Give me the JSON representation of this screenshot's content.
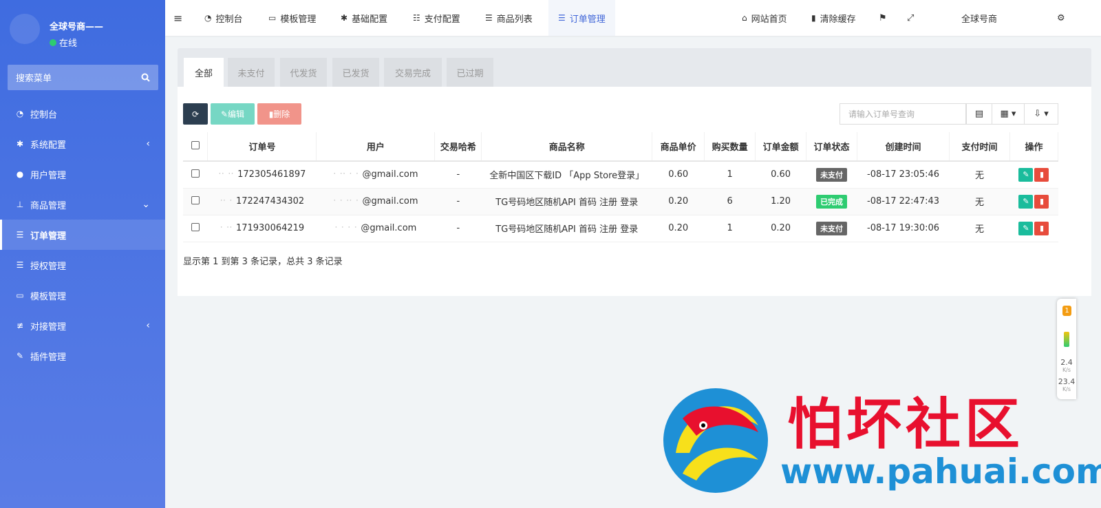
{
  "sidebar": {
    "username": "全球号商——",
    "status": "在线",
    "search_placeholder": "搜索菜单",
    "items": [
      {
        "label": "控制台",
        "icon": "dashboard-icon"
      },
      {
        "label": "系统配置",
        "icon": "gear-icon",
        "caret": "‹"
      },
      {
        "label": "用户管理",
        "icon": "user-icon"
      },
      {
        "label": "商品管理",
        "icon": "cart-icon",
        "caret": "⌄"
      },
      {
        "label": "订单管理",
        "icon": "list-icon",
        "active": true
      },
      {
        "label": "授权管理",
        "icon": "list-icon"
      },
      {
        "label": "模板管理",
        "icon": "template-icon"
      },
      {
        "label": "对接管理",
        "icon": "sliders-icon",
        "caret": "‹"
      },
      {
        "label": "插件管理",
        "icon": "plug-icon"
      }
    ]
  },
  "topbar": {
    "nav": [
      {
        "label": "控制台",
        "icon": "dashboard-icon"
      },
      {
        "label": "模板管理",
        "icon": "template-icon"
      },
      {
        "label": "基础配置",
        "icon": "gear-icon"
      },
      {
        "label": "支付配置",
        "icon": "server-icon"
      },
      {
        "label": "商品列表",
        "icon": "list-icon"
      },
      {
        "label": "订单管理",
        "icon": "list-icon",
        "active": true
      }
    ],
    "home_label": "网站首页",
    "clear_cache_label": "清除缓存",
    "account_name": "全球号商"
  },
  "tabs": [
    "全部",
    "未支付",
    "代发货",
    "已发货",
    "交易完成",
    "已过期"
  ],
  "toolbar": {
    "edit_label": "编辑",
    "delete_label": "删除",
    "search_placeholder": "请输入订单号查询"
  },
  "table": {
    "headers": [
      "订单号",
      "用户",
      "交易哈希",
      "商品名称",
      "商品单价",
      "购买数量",
      "订单金额",
      "订单状态",
      "创建时间",
      "支付时间",
      "操作"
    ],
    "rows": [
      {
        "order_no": "172305461897",
        "user": "@gmail.com",
        "hash": "-",
        "product": "全新中国区下载ID 「App Store登录」",
        "price": "0.60",
        "qty": "1",
        "amount": "0.60",
        "status": "未支付",
        "status_color": "#666666",
        "created": "-08-17 23:05:46",
        "paid": "无"
      },
      {
        "order_no": "172247434302",
        "user": "@gmail.com",
        "hash": "-",
        "product": "TG号码地区随机API 首码 注册 登录",
        "price": "0.20",
        "qty": "6",
        "amount": "1.20",
        "status": "已完成",
        "status_color": "#2ecc71",
        "created": "-08-17 22:47:43",
        "paid": "无"
      },
      {
        "order_no": "171930064219",
        "user": "@gmail.com",
        "hash": "-",
        "product": "TG号码地区随机API 首码 注册 登录",
        "price": "0.20",
        "qty": "1",
        "amount": "0.20",
        "status": "未支付",
        "status_color": "#666666",
        "created": "-08-17 19:30:06",
        "paid": "无"
      }
    ]
  },
  "footer": "显示第 1 到第 3 条记录，总共 3 条记录",
  "side_widget": {
    "badge": "1",
    "up_speed": "2.4",
    "up_unit": "K/s",
    "down_speed": "23.4",
    "down_unit": "K/s"
  },
  "watermark": {
    "title": "怕坏社区",
    "url": "www.pahuai.com"
  },
  "colors": {
    "sidebar": "#4a72e2",
    "accent": "#4066d8",
    "success": "#1abc9c",
    "danger": "#e74c3c",
    "dark_button": "#2c3e50",
    "edit_button": "#76d7c4",
    "delete_button": "#f1948a",
    "watermark_red": "#e8102e",
    "watermark_blue": "#1e90d6"
  }
}
